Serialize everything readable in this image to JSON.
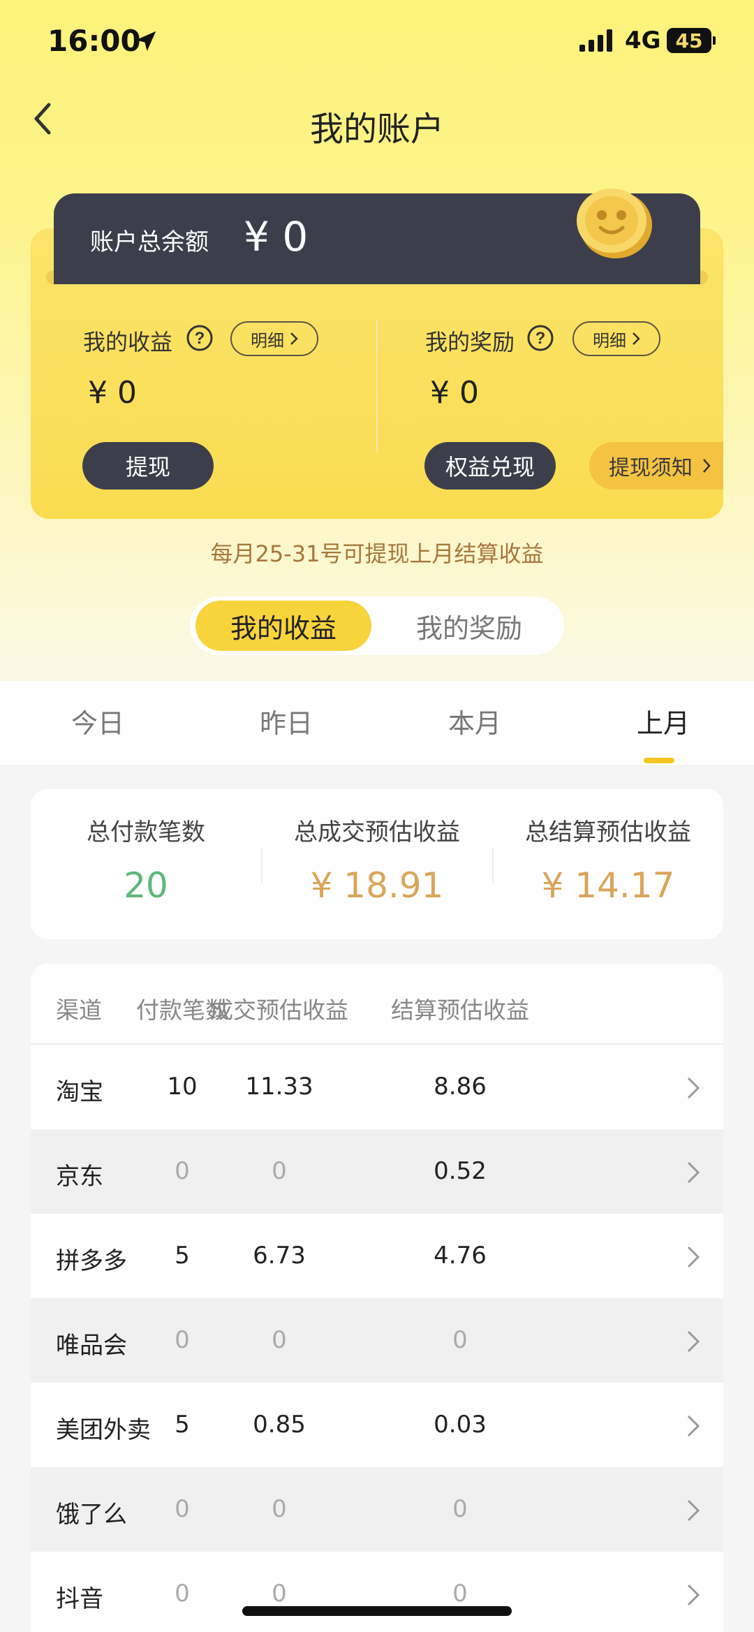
{
  "status_bar": {
    "time": "16:00",
    "network": "4G",
    "battery": "45"
  },
  "header": {
    "title": "我的账户"
  },
  "balance": {
    "label": "账户总余额",
    "value": "¥ 0"
  },
  "earnings": {
    "title": "我的收益",
    "detail": "明细",
    "value": "¥ 0",
    "button": "提现"
  },
  "rewards": {
    "title": "我的奖励",
    "detail": "明细",
    "value": "¥ 0",
    "button": "权益兑现"
  },
  "notice_button": "提现须知",
  "tip": "每月25-31号可提现上月结算收益",
  "segment": {
    "active": "我的收益",
    "inactive": "我的奖励"
  },
  "periods": [
    "今日",
    "昨日",
    "本月",
    "上月"
  ],
  "active_period": "上月",
  "summary": [
    {
      "label": "总付款笔数",
      "value": "20",
      "color": "#5cb87a"
    },
    {
      "label": "总成交预估收益",
      "value": "¥ 18.91",
      "color": "#d9a55a"
    },
    {
      "label": "总结算预估收益",
      "value": "¥ 14.17",
      "color": "#d9a55a"
    }
  ],
  "table": {
    "headers": [
      "渠道",
      "付款笔数",
      "成交预估收益",
      "结算预估收益"
    ],
    "rows": [
      {
        "channel": "淘宝",
        "payments": "10",
        "deal": "11.33",
        "settle": "8.86"
      },
      {
        "channel": "京东",
        "payments": "0",
        "deal": "0",
        "settle": "0.52"
      },
      {
        "channel": "拼多多",
        "payments": "5",
        "deal": "6.73",
        "settle": "4.76"
      },
      {
        "channel": "唯品会",
        "payments": "0",
        "deal": "0",
        "settle": "0"
      },
      {
        "channel": "美团外卖",
        "payments": "5",
        "deal": "0.85",
        "settle": "0.03"
      },
      {
        "channel": "饿了么",
        "payments": "0",
        "deal": "0",
        "settle": "0"
      },
      {
        "channel": "抖音",
        "payments": "0",
        "deal": "0",
        "settle": "0"
      }
    ]
  }
}
